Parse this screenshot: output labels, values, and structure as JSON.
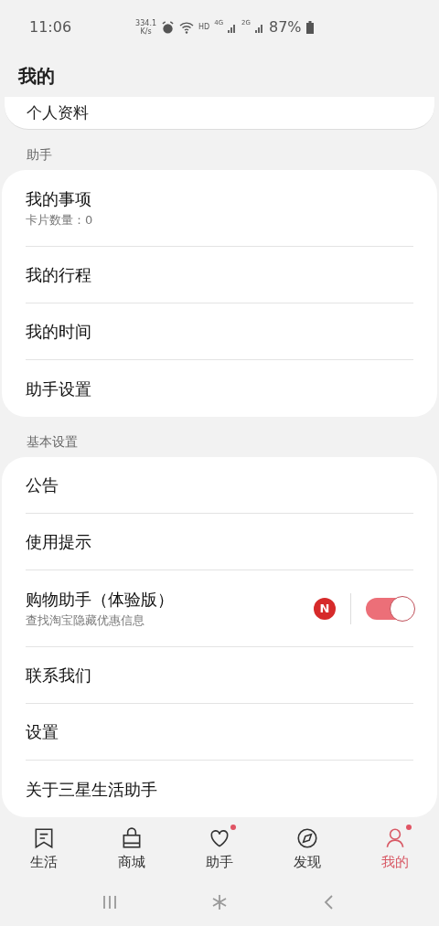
{
  "status_bar": {
    "time": "11:06",
    "speed": "334.1",
    "speed_unit": "K/s",
    "hd": "HD",
    "net1": "4G",
    "net2": "2G",
    "battery": "87%"
  },
  "header": {
    "title": "我的"
  },
  "top_card": {
    "label": "个人资料"
  },
  "sections": [
    {
      "title": "助手",
      "items": [
        {
          "kind": "plain",
          "label": "我的事项",
          "subtitle": "卡片数量：0"
        },
        {
          "kind": "plain",
          "label": "我的行程"
        },
        {
          "kind": "plain",
          "label": "我的时间"
        },
        {
          "kind": "plain",
          "label": "助手设置"
        }
      ]
    },
    {
      "title": "基本设置",
      "items": [
        {
          "kind": "plain",
          "label": "公告"
        },
        {
          "kind": "plain",
          "label": "使用提示"
        },
        {
          "kind": "toggle",
          "label": "购物助手（体验版）",
          "subtitle": "查找淘宝隐藏优惠信息",
          "badge": "N",
          "on": true
        },
        {
          "kind": "plain",
          "label": "联系我们"
        },
        {
          "kind": "plain",
          "label": "设置"
        },
        {
          "kind": "plain",
          "label": "关于三星生活助手"
        }
      ]
    }
  ],
  "tabs": [
    {
      "kind": "life",
      "label": "生活",
      "selected": false,
      "dot": false
    },
    {
      "kind": "mall",
      "label": "商城",
      "selected": false,
      "dot": false
    },
    {
      "kind": "heart",
      "label": "助手",
      "selected": false,
      "dot": true
    },
    {
      "kind": "compass",
      "label": "发现",
      "selected": false,
      "dot": false
    },
    {
      "kind": "person",
      "label": "我的",
      "selected": true,
      "dot": true
    }
  ]
}
